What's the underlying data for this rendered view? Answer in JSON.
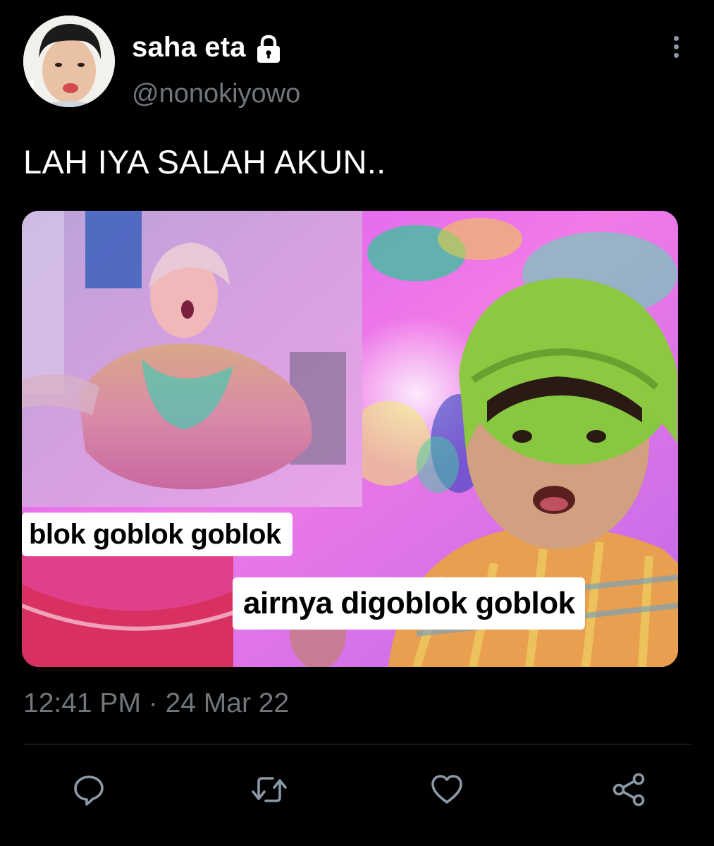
{
  "author": {
    "display_name": "saha eta",
    "handle": "@nonokiyowo",
    "protected_icon": "lock-icon",
    "avatar_icon": "avatar-photo"
  },
  "tweet": {
    "text": "LAH IYA SALAH AKUN..",
    "timestamp": "12:41 PM · 24 Mar 22"
  },
  "media": {
    "caption_top": "blok goblok goblok",
    "caption_bottom": "airnya digoblok goblok"
  },
  "actions": {
    "reply_icon": "reply-icon",
    "retweet_icon": "retweet-icon",
    "like_icon": "heart-icon",
    "share_icon": "share-icon",
    "more_icon": "more-vertical-icon"
  },
  "colors": {
    "background": "#000000",
    "primary_text": "#ffffff",
    "secondary_text": "#71767b",
    "divider": "#2f3336"
  }
}
